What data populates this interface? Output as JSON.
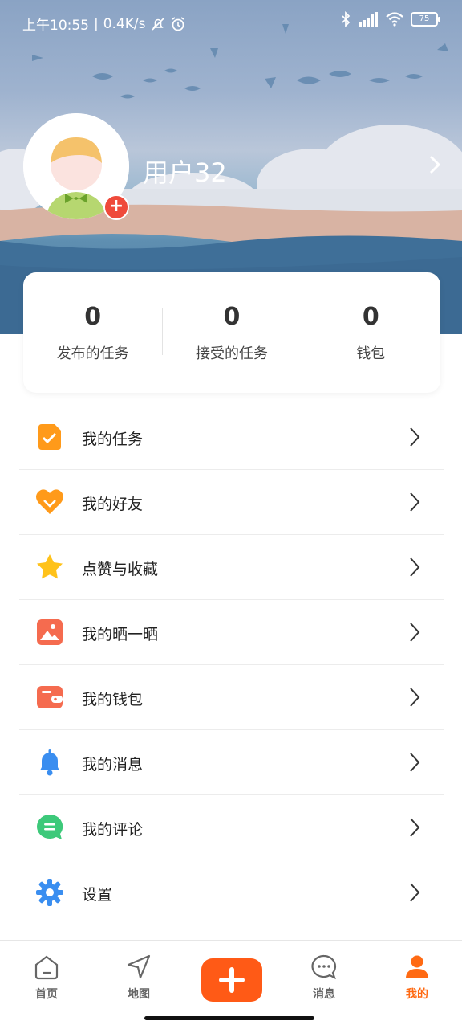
{
  "status_bar": {
    "time": "上午10:55",
    "network_speed": "0.4K/s",
    "battery": "75"
  },
  "profile": {
    "username": "用户32"
  },
  "stats": [
    {
      "value": "0",
      "label": "发布的任务"
    },
    {
      "value": "0",
      "label": "接受的任务"
    },
    {
      "value": "0",
      "label": "钱包"
    }
  ],
  "menu": [
    {
      "label": "我的任务",
      "icon": "task-icon"
    },
    {
      "label": "我的好友",
      "icon": "heart-icon"
    },
    {
      "label": "点赞与收藏",
      "icon": "star-icon"
    },
    {
      "label": "我的晒一晒",
      "icon": "photo-icon"
    },
    {
      "label": "我的钱包",
      "icon": "wallet-icon"
    },
    {
      "label": "我的消息",
      "icon": "bell-icon"
    },
    {
      "label": "我的评论",
      "icon": "comment-icon"
    },
    {
      "label": "设置",
      "icon": "gear-icon"
    }
  ],
  "tabbar": [
    {
      "label": "首页",
      "icon": "home-icon",
      "active": false
    },
    {
      "label": "地图",
      "icon": "navigation-icon",
      "active": false
    },
    {
      "label": "",
      "icon": "plus-icon",
      "active": false
    },
    {
      "label": "消息",
      "icon": "chat-bubble-icon",
      "active": false
    },
    {
      "label": "我的",
      "icon": "person-icon",
      "active": true
    }
  ],
  "colors": {
    "accent": "#ff6a13",
    "plus_button": "#ff5a16",
    "badge": "#ef4a3b"
  }
}
